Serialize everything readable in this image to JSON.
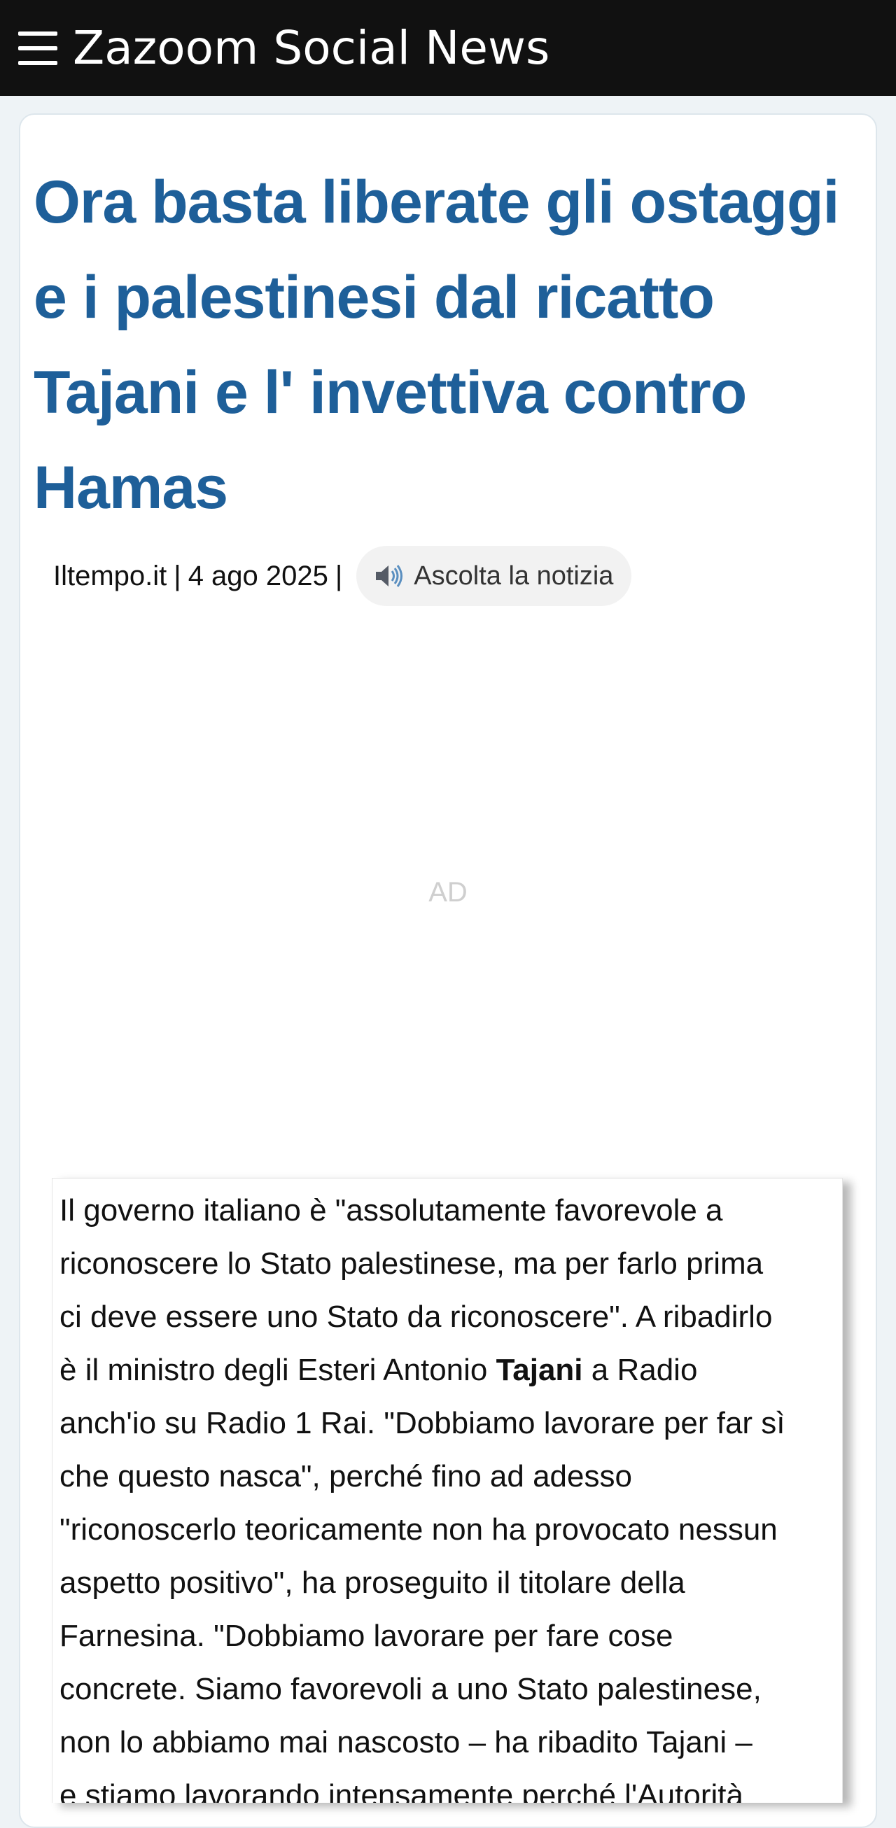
{
  "header": {
    "menu_icon": "hamburger-menu-icon",
    "brand": "Zazoom Social News"
  },
  "article": {
    "title_lines": [
      "Ora basta liberate gli ostaggi",
      "e i palestinesi dal ricatto",
      "Tajani e l' invettiva contro",
      "Hamas"
    ],
    "source": "Iltempo.it",
    "date": "4 ago 2025",
    "separator": "|",
    "listen_icon": "speaker-icon",
    "listen_label": "Ascolta la notizia",
    "ad_label": "AD",
    "body_lines": [
      "Il governo italiano è \"assolutamente favorevole a",
      "riconoscere lo Stato palestinese, ma per farlo prima",
      "ci deve essere uno Stato da riconoscere\". A ribadirlo",
      {
        "pre": "è il ministro degli Esteri Antonio ",
        "bold": "Tajani",
        "post": " a Radio"
      },
      "anch'io su Radio 1 Rai. \"Dobbiamo lavorare per far sì",
      "che questo nasca\", perché fino ad adesso",
      "\"riconoscerlo teoricamente non ha provocato nessun",
      "aspetto positivo\", ha proseguito il titolare della",
      "Farnesina. \"Dobbiamo lavorare per fare cose",
      "concrete. Siamo favorevoli a uno Stato palestinese,",
      "non lo abbiamo mai nascosto – ha ribadito Tajani –",
      "e stiamo lavorando intensamente perché l'Autorità"
    ]
  },
  "colors": {
    "topbar_bg": "#111111",
    "title": "#1e5f99",
    "page_bg": "#eef3f6"
  }
}
